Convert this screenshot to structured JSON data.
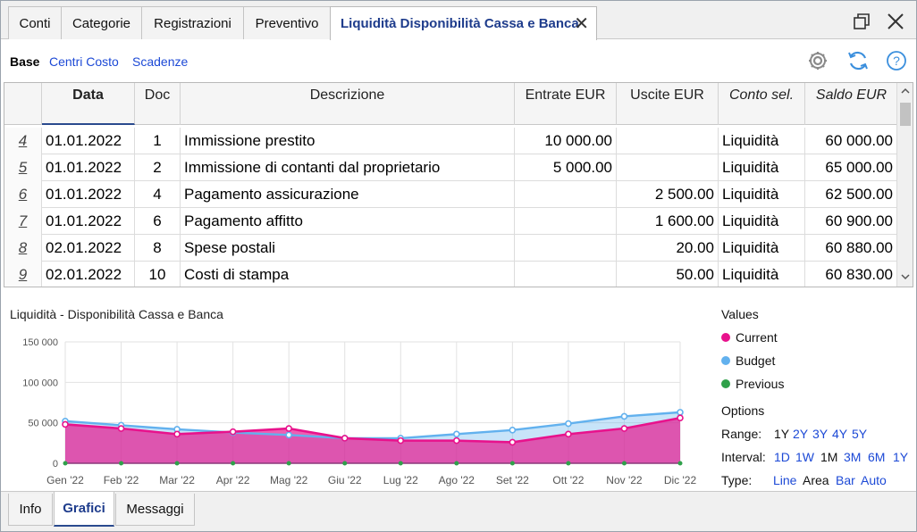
{
  "tabs": [
    {
      "label": "Conti"
    },
    {
      "label": "Categorie"
    },
    {
      "label": "Registrazioni"
    },
    {
      "label": "Preventivo"
    },
    {
      "label": "Liquidità Disponibilità Cassa e Banca"
    }
  ],
  "views": {
    "base": "Base",
    "centri": "Centri Costo",
    "scadenze": "Scadenze"
  },
  "columns": {
    "data": "Data",
    "doc": "Doc",
    "descrizione": "Descrizione",
    "entrate": "Entrate EUR",
    "uscite": "Uscite EUR",
    "conto": "Conto sel.",
    "saldo": "Saldo EUR"
  },
  "rows": [
    {
      "n": "4",
      "data": "01.01.2022",
      "doc": "1",
      "desc": "Immissione prestito",
      "entrate": "10 000.00",
      "uscite": "",
      "conto": "Liquidità",
      "saldo": "60 000.00"
    },
    {
      "n": "5",
      "data": "01.01.2022",
      "doc": "2",
      "desc": "Immissione di contanti dal proprietario",
      "entrate": "5 000.00",
      "uscite": "",
      "conto": "Liquidità",
      "saldo": "65 000.00"
    },
    {
      "n": "6",
      "data": "01.01.2022",
      "doc": "4",
      "desc": "Pagamento assicurazione",
      "entrate": "",
      "uscite": "2 500.00",
      "conto": "Liquidità",
      "saldo": "62 500.00"
    },
    {
      "n": "7",
      "data": "01.01.2022",
      "doc": "6",
      "desc": "Pagamento affitto",
      "entrate": "",
      "uscite": "1 600.00",
      "conto": "Liquidità",
      "saldo": "60 900.00"
    },
    {
      "n": "8",
      "data": "02.01.2022",
      "doc": "8",
      "desc": "Spese postali",
      "entrate": "",
      "uscite": "20.00",
      "conto": "Liquidità",
      "saldo": "60 880.00"
    },
    {
      "n": "9",
      "data": "02.01.2022",
      "doc": "10",
      "desc": "Costi di stampa",
      "entrate": "",
      "uscite": "50.00",
      "conto": "Liquidità",
      "saldo": "60 830.00"
    }
  ],
  "chart_data": {
    "type": "area",
    "title": "Liquidità - Disponibilità Cassa e Banca",
    "categories": [
      "Gen '22",
      "Feb '22",
      "Mar '22",
      "Apr '22",
      "Mag '22",
      "Giu '22",
      "Lug '22",
      "Ago '22",
      "Set '22",
      "Ott '22",
      "Nov '22",
      "Dic '22"
    ],
    "y_ticks": [
      "0",
      "50 000",
      "100 000",
      "150 000"
    ],
    "ylim": [
      0,
      150000
    ],
    "series": [
      {
        "name": "Current",
        "color": "#e8128c",
        "values": [
          48000,
          43000,
          36000,
          39000,
          43000,
          31000,
          28000,
          28000,
          26000,
          36000,
          43000,
          56000
        ]
      },
      {
        "name": "Budget",
        "color": "#62b1ee",
        "values": [
          52000,
          47000,
          42000,
          38000,
          35000,
          31000,
          31000,
          36000,
          41000,
          49000,
          58000,
          63000
        ]
      },
      {
        "name": "Previous",
        "color": "#2fa14a",
        "values": [
          0,
          0,
          0,
          0,
          0,
          0,
          0,
          0,
          0,
          0,
          0,
          0
        ]
      }
    ],
    "grid": true,
    "legend_position": "right"
  },
  "sidebar": {
    "values_title": "Values",
    "options_title": "Options",
    "range_label": "Range:",
    "range_options": [
      "1Y",
      "2Y",
      "3Y",
      "4Y",
      "5Y"
    ],
    "interval_label": "Interval:",
    "interval_options": [
      "1D",
      "1W",
      "1M",
      "3M",
      "6M",
      "1Y"
    ],
    "type_label": "Type:",
    "type_options": [
      "Line",
      "Area",
      "Bar",
      "Auto"
    ]
  },
  "bottom_tabs": [
    {
      "label": "Info"
    },
    {
      "label": "Grafici"
    },
    {
      "label": "Messaggi"
    }
  ]
}
